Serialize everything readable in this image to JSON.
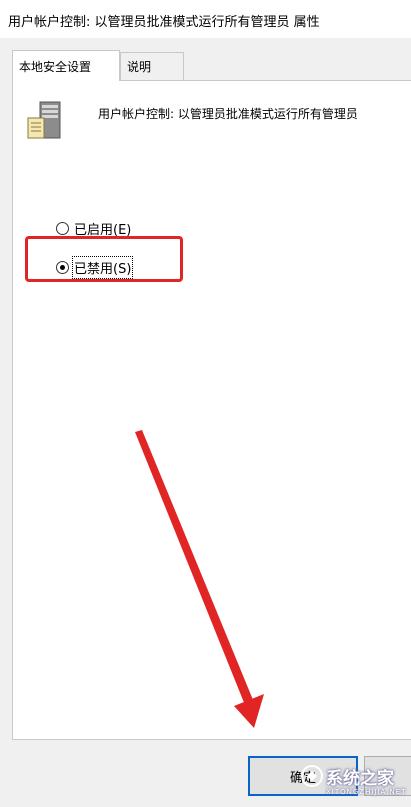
{
  "window": {
    "title": "用户帐户控制: 以管理员批准模式运行所有管理员 属性"
  },
  "tabs": [
    {
      "label": "本地安全设置",
      "active": true
    },
    {
      "label": "说明",
      "active": false
    }
  ],
  "policy": {
    "icon": "policy-server-icon",
    "name": "用户帐户控制: 以管理员批准模式运行所有管理员"
  },
  "options": [
    {
      "label": "已启用(E)",
      "checked": false
    },
    {
      "label": "已禁用(S)",
      "checked": true
    }
  ],
  "buttons": {
    "ok_label": "确定"
  },
  "annotation": {
    "highlight_color": "#e12424",
    "arrow_color": "#e12424"
  },
  "watermark": {
    "text": "系统之家",
    "sub": "XITONGZHIJIA.NET"
  }
}
